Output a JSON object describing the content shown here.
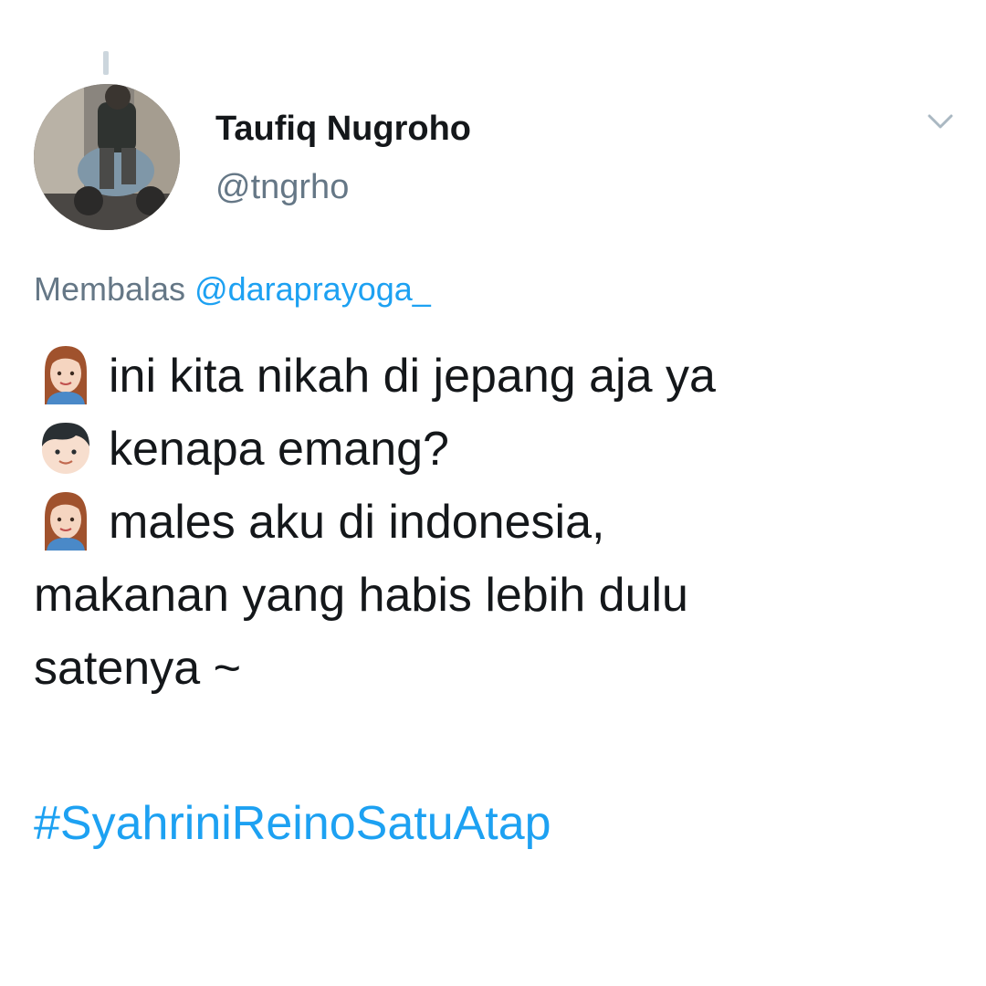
{
  "tweet": {
    "author": {
      "display_name": "Taufiq Nugroho",
      "handle": "@tngrho"
    },
    "reply_to": {
      "prefix": "Membalas",
      "mention": "@daraprayoga_"
    },
    "lines": [
      {
        "emoji": "woman-emoji",
        "text": "ini kita nikah di jepang aja ya"
      },
      {
        "emoji": "boy-emoji",
        "text": "kenapa emang?"
      },
      {
        "emoji": "woman-emoji",
        "text": "males aku di indonesia,"
      },
      {
        "emoji": "",
        "text": "makanan yang habis lebih dulu"
      },
      {
        "emoji": "",
        "text": "satenya ~"
      }
    ],
    "hashtag": "#SyahriniReinoSatuAtap"
  },
  "icons": {
    "menu": "chevron-down-icon"
  },
  "colors": {
    "text": "#14171a",
    "secondary": "#657786",
    "link": "#1da1f2",
    "background": "#ffffff"
  }
}
